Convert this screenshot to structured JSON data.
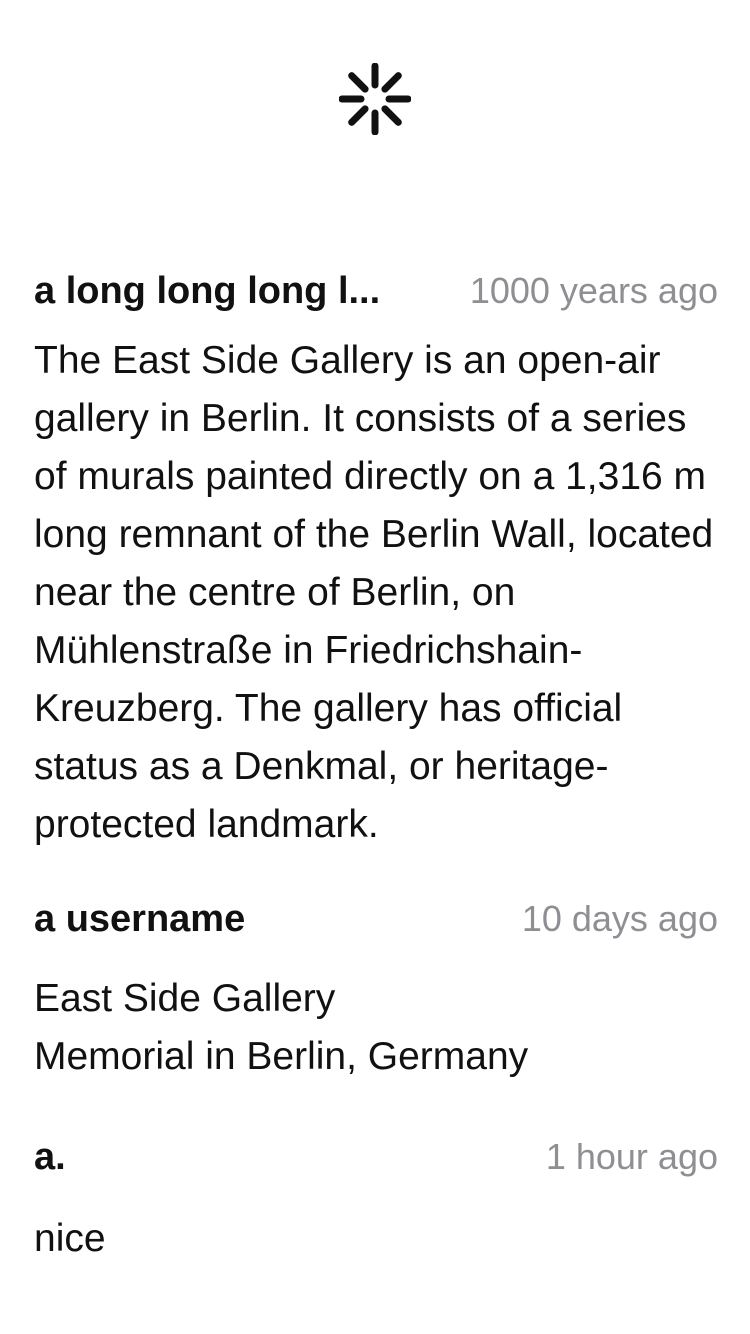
{
  "loading_indicator": {
    "icon": "spinner-icon"
  },
  "comments": [
    {
      "author": "a long long long l...",
      "time": "1000 years ago",
      "body": "The East Side Gallery is an open-air gallery in Berlin. It consists of a series of murals painted directly on a 1,316 m long remnant of the Berlin Wall, located near the centre of Berlin, on Mühlenstraße in Friedrichshain-Kreuzberg. The gallery has official status as a Denkmal, or heritage-protected landmark."
    },
    {
      "author": "a username",
      "time": "10 days ago",
      "body": "East Side Gallery\nMemorial in Berlin, Germany"
    },
    {
      "author": "a.",
      "time": "1 hour ago",
      "body": "nice"
    }
  ]
}
